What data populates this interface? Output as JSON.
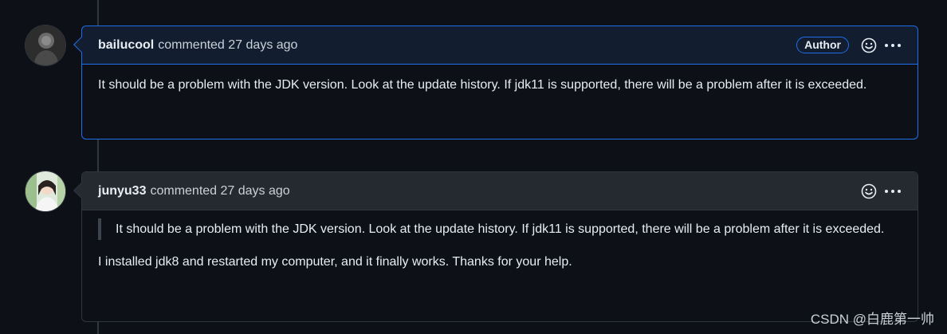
{
  "comments": [
    {
      "username": "bailucool",
      "meta": "commented 27 days ago",
      "badge": "Author",
      "body": "It should be a problem with the JDK version. Look at the update history. If jdk11 is supported, there will be a problem after it is exceeded."
    },
    {
      "username": "junyu33",
      "meta": "commented 27 days ago",
      "quote": "It should be a problem with the JDK version. Look at the update history. If jdk11 is supported, there will be a problem after it is exceeded.",
      "body": "I installed jdk8 and restarted my computer, and it finally works. Thanks for your help."
    }
  ],
  "icons": {
    "reaction": "smiley-icon",
    "more": "kebab-horizontal-icon"
  },
  "colors": {
    "background": "#0d1117",
    "author_border": "#1f6feb",
    "default_border": "#30363d",
    "text": "#e6edf3"
  },
  "watermark": "CSDN @白鹿第一帅"
}
